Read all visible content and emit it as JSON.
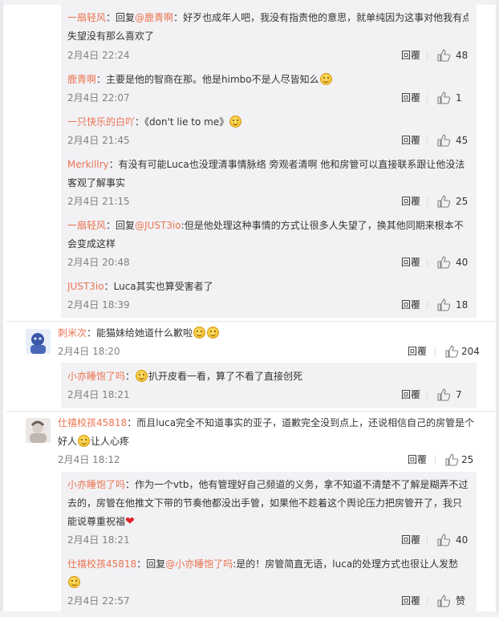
{
  "reply_label": "回覆",
  "comments": [
    {
      "user": "一扇轻风",
      "reply_prefix": "回复",
      "at": "@鹿青啊",
      "text1": "好歹也成年人吧，我没有指责他的意思，就单纯因为这事对他我有点",
      "text2": "失望没有那么喜欢了",
      "time": "2月4日 22:24",
      "likes": "48"
    },
    {
      "user": "鹿青啊",
      "text1": "主要是他的智商在那。他是himbo不是人尽皆知么",
      "emoji1": "laugh-cry-emoji",
      "time": "2月4日 22:07",
      "likes": "1"
    },
    {
      "user": "一只快乐的白吖",
      "text1": "《don't lie to me》",
      "emoji1": "smile-emoji",
      "time": "2月4日 21:45",
      "likes": "45"
    },
    {
      "user": "Merkillry",
      "text1": "有没有可能Luca也没理清事情脉络 旁观者清啊 他和房管可以直接联系跟让他没法",
      "text2": "客观了解事实",
      "time": "2月4日 21:15",
      "likes": "25"
    },
    {
      "user": "一扇轻风",
      "reply_prefix": "回复",
      "at": "@JUST3io",
      "text1": "但是他处理这种事情的方式让很多人失望了，换其他同期来根本不",
      "text2": "会变成这样",
      "time": "2月4日 20:48",
      "likes": "40"
    },
    {
      "user": "JUST3io",
      "text1": "Luca其实也算受害者了",
      "time": "2月4日 18:39",
      "likes": "18"
    },
    {
      "user": "刺米次",
      "text1": "能猫妹给她道什么歉啦",
      "emoji1": "pleading-emoji",
      "emoji2": "pleading-emoji",
      "time": "2月4日 18:20",
      "likes": "204"
    },
    {
      "user": "小亦睡饱了吗",
      "text1": "扒开皮看一看，算了不看了直接创死",
      "emoji_before": "smirk-emoji",
      "time": "2月4日 18:21",
      "likes": "7"
    },
    {
      "user": "仕禧校孩45818",
      "text1": "而且luca完全不知道事实的亚子，道歉完全没到点上，还说相信自己的房管是个",
      "text2a": "好人",
      "emoji1": "laugh-cry-emoji",
      "text2b": "让人心疼",
      "time": "2月4日 18:12",
      "likes": "25"
    },
    {
      "user": "小亦睡饱了吗",
      "text1": "作为一个vtb，他有管理好自己频道的义务，拿不知道不清楚不了解是糊弄不过",
      "text2": "去的，房管在他推文下带的节奏他都没出手管，如果他不趁着这个舆论压力把房管开了，我只",
      "text3": "能说尊重祝福",
      "emoji1": "heart-emoji",
      "time": "2月4日 18:21",
      "likes": "40"
    },
    {
      "user": "仕禧校孩45818",
      "reply_prefix": "回复",
      "at": "@小亦睡饱了吗",
      "text1": "是的！房管简直无语，luca的处理方式也很让人发愁",
      "emoji1": "laugh-cry-emoji",
      "time": "2月4日 22:57",
      "likes": "赞"
    }
  ]
}
